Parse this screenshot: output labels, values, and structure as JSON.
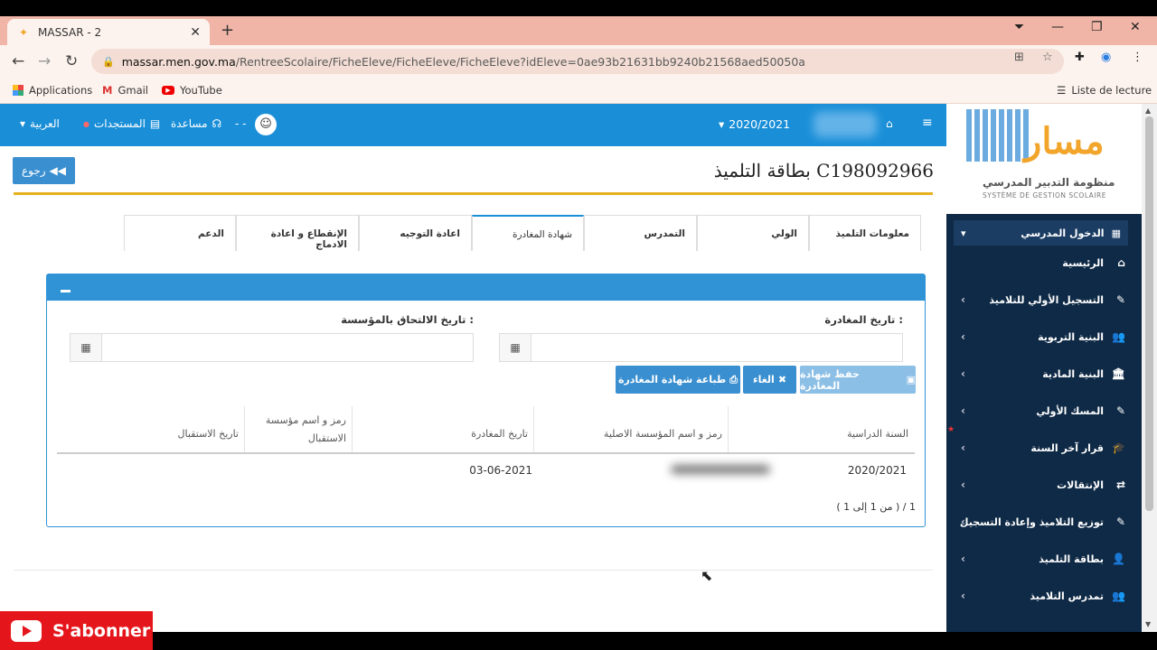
{
  "browser": {
    "tab_title": "MASSAR - 2",
    "url_host": "massar.men.gov.ma",
    "url_path": "/RentreeScolaire/FicheEleve/FicheEleve/FicheEleve?idEleve=0ae93b21631bb9240b21568aed50050a",
    "bookmarks": [
      "Applications",
      "Gmail",
      "YouTube"
    ],
    "reading_list": "Liste de lecture"
  },
  "topnav": {
    "language": "العربية",
    "updates": "المستجدات",
    "help": "مساعدة",
    "user": "- -",
    "school_year": "2020/2021"
  },
  "sidebar": {
    "logo_text": "مسار",
    "logo_sub_ar": "منظومة التدبير المدرسي",
    "logo_sub_fr": "SYSTÈME DE GESTION SCOLAIRE",
    "section": "الدخول المدرسي",
    "items": [
      "الرئيسية",
      "التسجيل الأولي للتلاميذ",
      "البنية التربوية",
      "البنية المادية",
      "المسك الأولي",
      "قرار آخر السنة",
      "الإنتقالات",
      "توزيع التلاميذ وإعادة التسجيل",
      "بطاقة التلميذ",
      "تمدرس التلاميذ"
    ]
  },
  "page": {
    "title": "بطاقة التلميذ C198092966",
    "back_label": "رجوع",
    "tabs": [
      "معلومات التلميذ",
      "الولي",
      "التمدرس",
      "شهادة المغادرة",
      "اعادة التوجيه",
      "الإنقطاع و اعادة الادماج",
      "الدعم"
    ],
    "active_tab": "شهادة المغادرة",
    "leave_date_label": "تاريخ المغادرة :",
    "join_date_label": "تاريخ الالتحاق بالمؤسسة :",
    "buttons": {
      "save": "حفظ شهادة المغادرة",
      "cancel": "الغاء",
      "print": "طباعة شهادة المغادرة"
    },
    "table": {
      "headers": [
        "السنة الدراسية",
        "رمز و اسم المؤسسة الاصلية",
        "تاريخ المغادرة",
        "رمز و اسم مؤسسة الاستقبال",
        "تاريخ الاستقبال"
      ],
      "rows": [
        [
          "2020/2021",
          "",
          "03-06-2021",
          "",
          ""
        ]
      ]
    },
    "pager": "( من 1 إلى 1 ) / 1"
  },
  "overlay": {
    "subscribe": "S'abonner"
  }
}
